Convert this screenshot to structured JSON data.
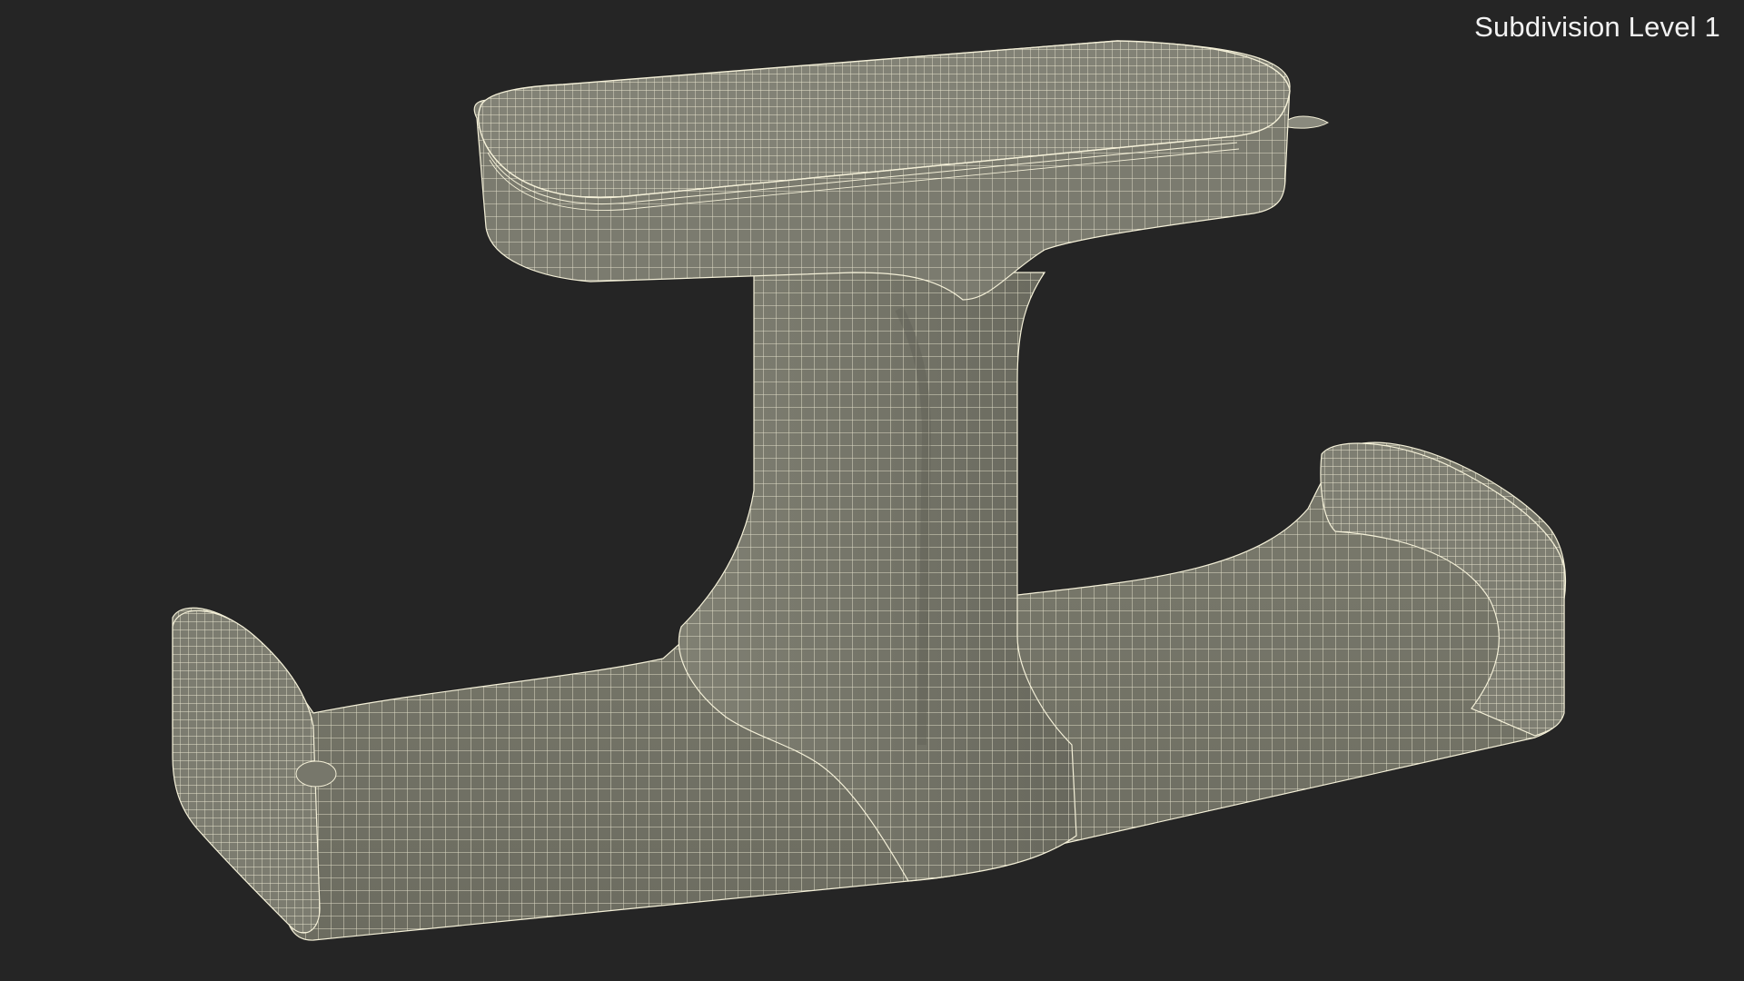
{
  "viewport": {
    "label": "Subdivision Level 1",
    "background_color": "#252525",
    "mesh_fill_color": "#76766a",
    "wireframe_color": "#f4f0d8"
  }
}
